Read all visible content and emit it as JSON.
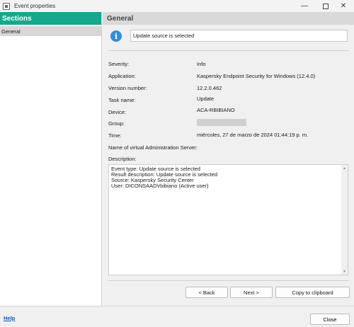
{
  "window": {
    "title": "Event properties"
  },
  "sidebar": {
    "header": "Sections",
    "items": [
      {
        "label": "General"
      }
    ]
  },
  "main": {
    "header": "General",
    "summary": "Update source is selected",
    "fields": {
      "severity": {
        "label": "Severity:",
        "value": "Info"
      },
      "application": {
        "label": "Application:",
        "value": "Kaspersky Endpoint Security for Windows (12.4.0)"
      },
      "version": {
        "label": "Version number:",
        "value": "12.2.0.462"
      },
      "task": {
        "label": "Task name:",
        "value": "Update"
      },
      "device": {
        "label": "Device:",
        "value": "ACA-RBIBIANO"
      },
      "group": {
        "label": "Group:"
      },
      "time": {
        "label": "Time:",
        "value": "miércoles, 27 de marzo de 2024 01:44:19 p. m."
      },
      "vas": {
        "label": "Name of virtual Administration Server:"
      },
      "description": {
        "label": "Description:"
      }
    },
    "description_lines": [
      "Event type: Update source is selected",
      "Result description: Update source is selected",
      "Source: Kaspersky Security Center",
      "User: DICONSAAD\\rbibiano (Active user)"
    ],
    "buttons": {
      "back": "< Back",
      "next": "Next >",
      "copy": "Copy to clipboard"
    }
  },
  "footer": {
    "help": "Help",
    "close": "Close"
  }
}
